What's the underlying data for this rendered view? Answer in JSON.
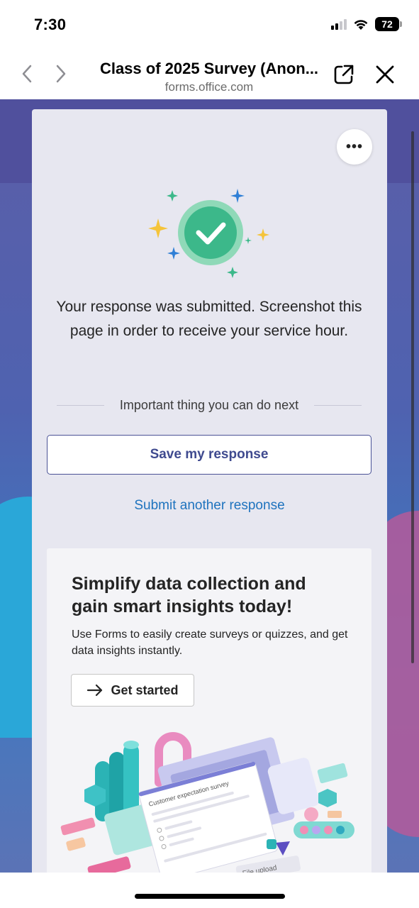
{
  "status_bar": {
    "time": "7:30",
    "battery": "72"
  },
  "browser": {
    "title": "Class of 2025 Survey (Anon...",
    "domain": "forms.office.com"
  },
  "card": {
    "more_label": "•••",
    "confirmation": "Your response was submitted. Screenshot this page in order to receive your service hour.",
    "next_heading": "Important thing you can do next",
    "save_button": "Save my response",
    "submit_another": "Submit another response"
  },
  "promo": {
    "title": "Simplify data collection and gain smart insights today!",
    "description": "Use Forms to easily create surveys or quizzes, and get data insights instantly.",
    "cta": "Get started",
    "illustration": {
      "survey_title": "Customer expectation survey",
      "upload_label": "File upload"
    }
  },
  "icons": {
    "back": "chevron-left-icon",
    "forward": "chevron-right-icon",
    "external": "open-external-icon",
    "close": "close-icon",
    "success": "check-circle-icon",
    "arrow": "arrow-right-icon"
  },
  "colors": {
    "primary": "#3f4a8f",
    "link": "#1e73be",
    "success": "#3cb88a"
  }
}
